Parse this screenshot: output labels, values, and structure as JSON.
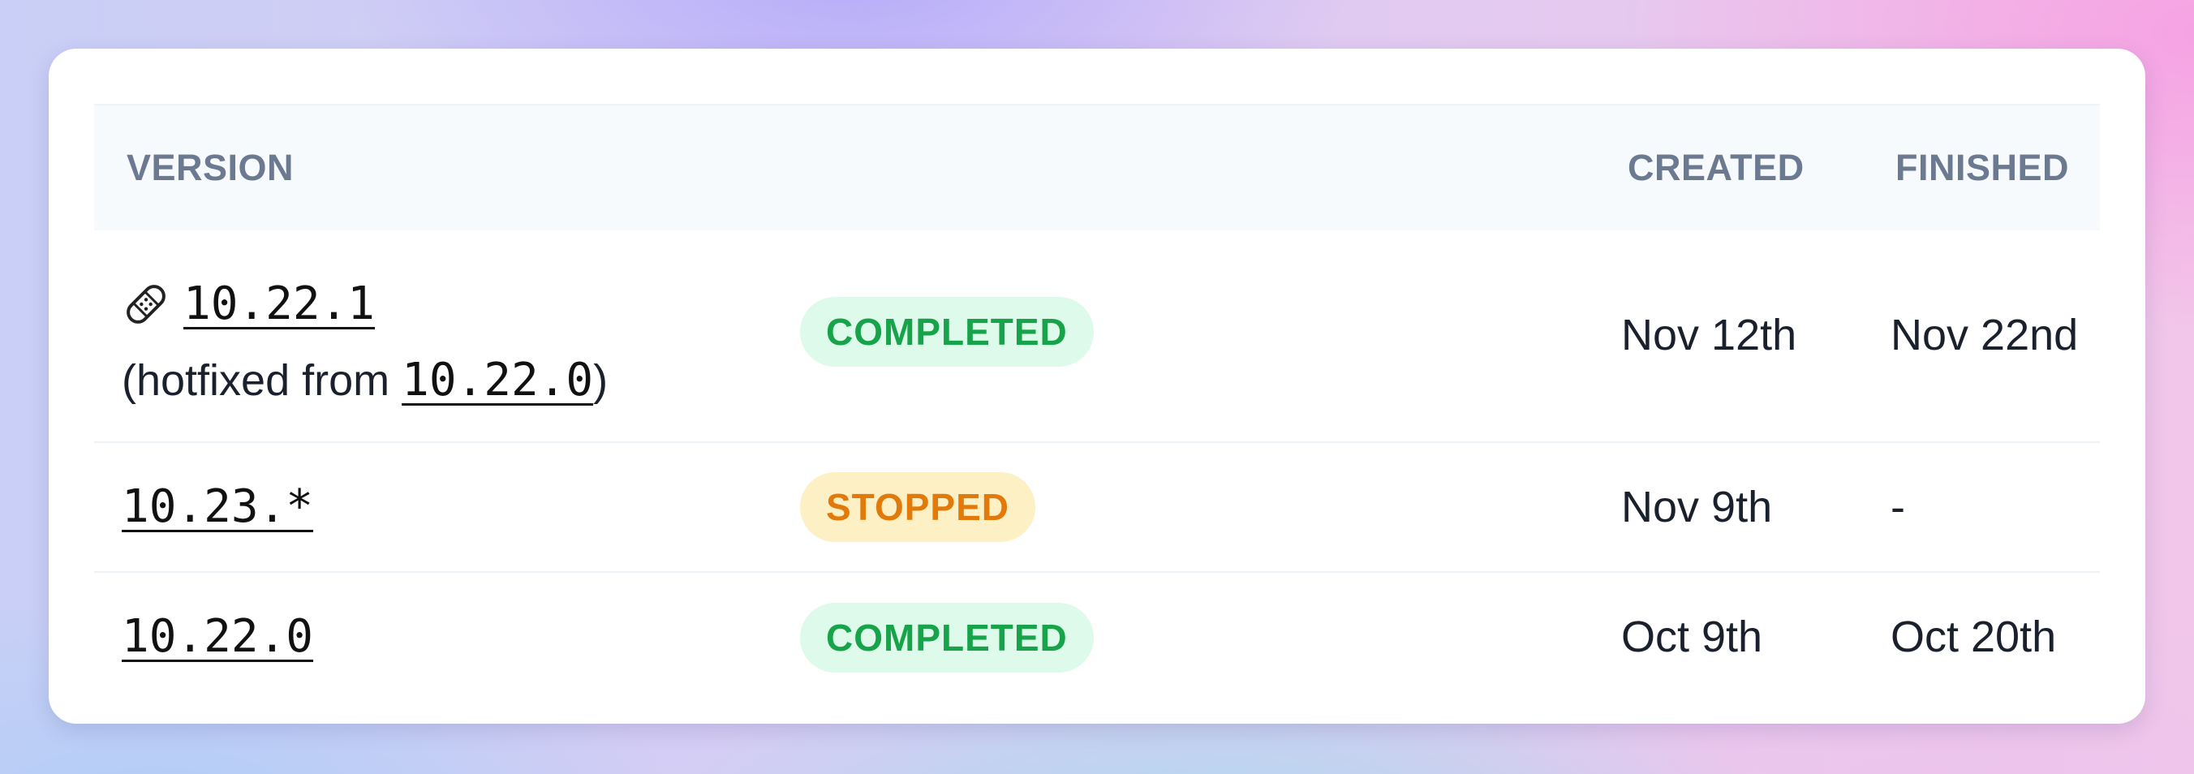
{
  "table": {
    "headers": {
      "version": "VERSION",
      "created": "CREATED",
      "finished": "FINISHED"
    },
    "rows": [
      {
        "version": "10.22.1",
        "icon": "bandage-icon",
        "hotfix_prefix": "(hotfixed from ",
        "hotfix_version": "10.22.0",
        "hotfix_suffix": ")",
        "status": "COMPLETED",
        "created": "Nov 12th",
        "finished": "Nov 22nd"
      },
      {
        "version": "10.23.*",
        "status": "STOPPED",
        "created": "Nov 9th",
        "finished": "-"
      },
      {
        "version": "10.22.0",
        "status": "COMPLETED",
        "created": "Oct 9th",
        "finished": "Oct 20th"
      }
    ]
  },
  "colors": {
    "completed_text": "#16a34a",
    "completed_bg": "#defaeb",
    "stopped_text": "#e17a0a",
    "stopped_bg": "#fdf0c4",
    "header_text": "#6b7a90"
  }
}
